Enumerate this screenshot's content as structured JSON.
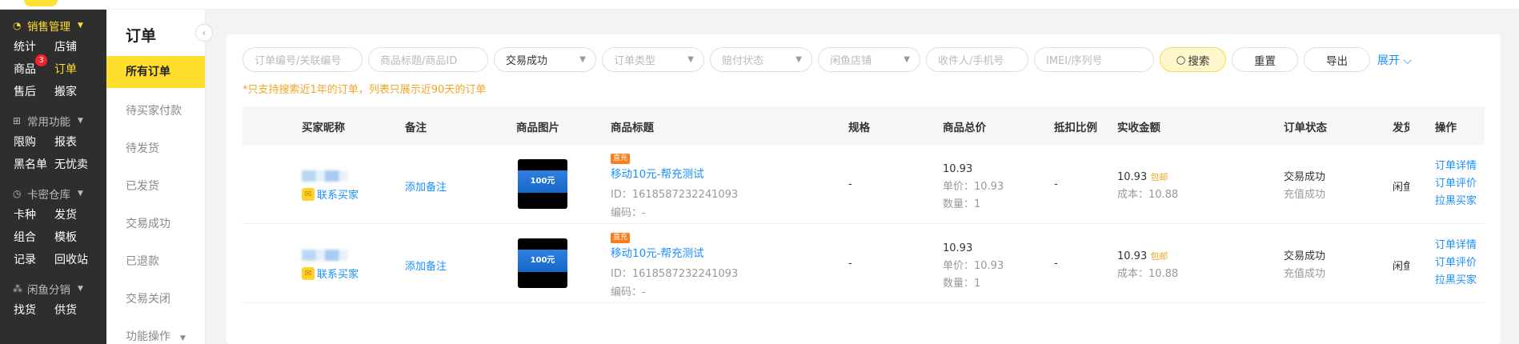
{
  "leftnav": {
    "groups": [
      {
        "title": "销售管理",
        "icon": "sales-icon",
        "active": true,
        "rows": [
          [
            {
              "label": "统计"
            },
            {
              "label": "店铺"
            }
          ],
          [
            {
              "label": "商品",
              "badge": "3"
            },
            {
              "label": "订单",
              "active": true
            }
          ],
          [
            {
              "label": "售后"
            },
            {
              "label": "搬家"
            }
          ]
        ]
      },
      {
        "title": "常用功能",
        "icon": "grid-icon",
        "rows": [
          [
            {
              "label": "限购"
            },
            {
              "label": "报表"
            }
          ],
          [
            {
              "label": "黑名单"
            },
            {
              "label": "无忧卖"
            }
          ]
        ]
      },
      {
        "title": "卡密仓库",
        "icon": "warehouse-icon",
        "rows": [
          [
            {
              "label": "卡种"
            },
            {
              "label": "发货"
            }
          ],
          [
            {
              "label": "组合"
            },
            {
              "label": "模板"
            }
          ],
          [
            {
              "label": "记录"
            },
            {
              "label": "回收站"
            }
          ]
        ]
      },
      {
        "title": "闲鱼分销",
        "icon": "distribution-icon",
        "rows": [
          [
            {
              "label": "找货"
            },
            {
              "label": "供货"
            }
          ]
        ]
      }
    ]
  },
  "subnav": {
    "title": "订单",
    "items": [
      "所有订单",
      "待买家付款",
      "待发货",
      "已发货",
      "交易成功",
      "已退款",
      "交易关闭",
      "功能操作"
    ],
    "active_index": 0
  },
  "filters": {
    "order_no_placeholder": "订单编号/关联编号",
    "title_placeholder": "商品标题/商品ID",
    "trade_status_value": "交易成功",
    "order_type_placeholder": "订单类型",
    "compensation_placeholder": "赔付状态",
    "shop_placeholder": "闲鱼店铺",
    "receiver_placeholder": "收件人/手机号",
    "imei_placeholder": "IMEI/序列号",
    "search_label": "搜索",
    "reset_label": "重置",
    "export_label": "导出",
    "expand_label": "展开"
  },
  "hint": "*只支持搜索近1年的订单，列表只展示近90天的订单",
  "table": {
    "headers": {
      "buyer": "买家昵称",
      "remark": "备注",
      "image": "商品图片",
      "title": "商品标题",
      "spec": "规格",
      "total": "商品总价",
      "ratio": "抵扣比例",
      "received": "实收金额",
      "status": "订单状态",
      "ship": "发货",
      "actions": "操作"
    },
    "rows": [
      {
        "contact_label": "联系买家",
        "remark_label": "添加备注",
        "thumb_text": "100元",
        "tag": "直充",
        "title": "移动10元-帮充测试",
        "id_text": "ID：1618587232241093",
        "code_text": "编码：-",
        "spec": "-",
        "total": "10.93",
        "unit_price": "单价：10.93",
        "quantity": "数量：1",
        "ratio": "-",
        "received": "10.93",
        "shipping_tag": "包邮",
        "cost": "成本：10.88",
        "status": "交易成功",
        "sub_status": "充值成功",
        "ship": "闲鱼",
        "actions": [
          "订单详情",
          "订单评价",
          "拉黑买家"
        ]
      },
      {
        "contact_label": "联系买家",
        "remark_label": "添加备注",
        "thumb_text": "100元",
        "tag": "直充",
        "title": "移动10元-帮充测试",
        "id_text": "ID：1618587232241093",
        "code_text": "编码：-",
        "spec": "-",
        "total": "10.93",
        "unit_price": "单价：10.93",
        "quantity": "数量：1",
        "ratio": "-",
        "received": "10.93",
        "shipping_tag": "包邮",
        "cost": "成本：10.88",
        "status": "交易成功",
        "sub_status": "充值成功",
        "ship": "闲鱼",
        "actions": [
          "订单详情",
          "订单评价",
          "拉黑买家"
        ]
      }
    ]
  },
  "colors": {
    "accent": "#ffde2d",
    "link": "#1890ff",
    "warning": "#f5a623",
    "nav_bg": "#2e2e2e"
  }
}
